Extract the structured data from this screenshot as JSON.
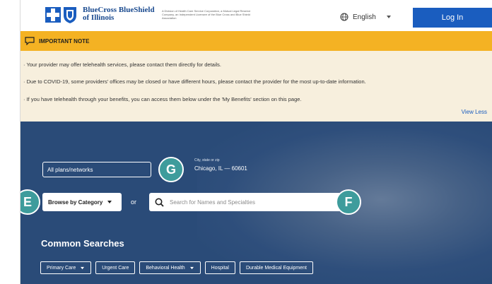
{
  "header": {
    "brand": "BlueCross BlueShield of Illinois",
    "tagline": "A Division of Health Care Service Corporation, a Mutual Legal Reserve Company, an Independent Licensee of the Blue Cross and Blue Shield Association",
    "language": "English",
    "login_label": "Log In",
    "icons": {
      "globe": "globe-icon",
      "caret": "chevron-down-icon"
    }
  },
  "note": {
    "title": "IMPORTANT NOTE",
    "lines": [
      "· Your provider may offer telehealth services, please contact them directly for details.",
      "· Due to COVID-19, some providers' offices may be closed or have different hours, please contact the provider for the most up-to-date information.",
      "· If you have telehealth through your benefits, you can access them below under the 'My Benefits' section on this page."
    ],
    "view_less": "View Less"
  },
  "search": {
    "plans_value": "All plans/networks",
    "location_label": "City, state or zip",
    "location_value": "Chicago, IL — 60601",
    "browse_label": "Browse by Category",
    "or_text": "or",
    "search_placeholder": "Search for Names and Specialties"
  },
  "badges": {
    "g": "G",
    "e": "E",
    "f": "F"
  },
  "common": {
    "title": "Common Searches",
    "chips": [
      "Primary Care",
      "Urgent Care",
      "Behavioral Health",
      "Hospital",
      "Durable Medical Equipment"
    ]
  },
  "colors": {
    "accent_yellow": "#f4b223",
    "note_bg": "#f7efdd",
    "primary_blue": "#1a5dbf",
    "hero_bg": "#2a4b78",
    "badge_teal": "#3e9c9c"
  }
}
